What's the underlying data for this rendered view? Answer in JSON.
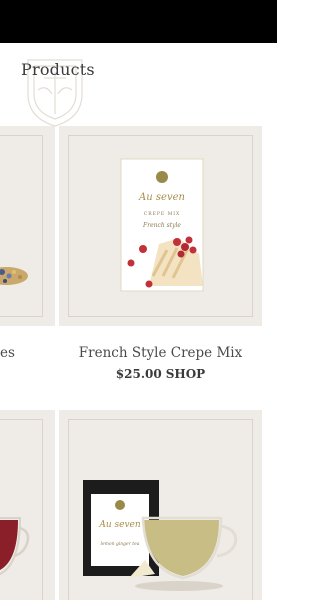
{
  "section": {
    "title": "Products"
  },
  "products": [
    {
      "name": "es"
    },
    {
      "name": "French Style Crepe Mix",
      "price": "$25.00",
      "action": "SHOP"
    }
  ],
  "colors": {
    "topbar": "#000000",
    "card_bg": "#efebe6",
    "card_border": "#d9d3ca",
    "text": "#4a4a4a",
    "gold": "#b39a5b"
  }
}
